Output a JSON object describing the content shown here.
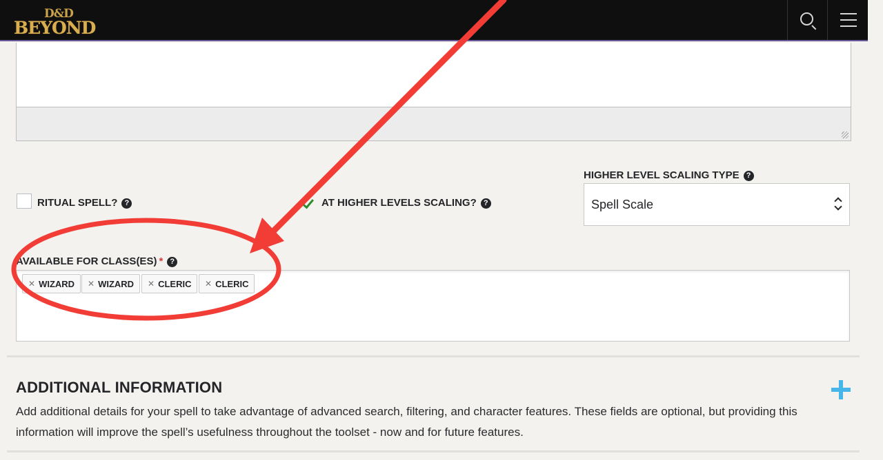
{
  "header": {
    "logo_top": "D&D",
    "logo_bottom": "BEYOND",
    "search_icon": "search-icon",
    "menu_icon": "hamburger-menu-icon",
    "bar_color": "#0f0f10"
  },
  "form": {
    "ritual_label": "RITUAL SPELL?",
    "ritual_checked": false,
    "higher_levels_label": "AT HIGHER LEVELS SCALING?",
    "higher_levels_checked": true,
    "scaling_type_label": "HIGHER LEVEL SCALING TYPE",
    "scaling_type_value": "Spell Scale",
    "classes_label": "AVAILABLE FOR CLASS(ES)",
    "required_mark": "*",
    "help_glyph": "?",
    "classes": [
      "WIZARD",
      "WIZARD",
      "CLERIC",
      "CLERIC"
    ]
  },
  "additional": {
    "title": "ADDITIONAL INFORMATION",
    "description": "Add additional details for your spell to take advantage of advanced search, filtering, and character features. These fields are optional, but providing this information will improve the spell’s usefulness throughout the toolset - now and for future features.",
    "expand_icon": "plus-icon"
  },
  "colors": {
    "accent_blue": "#46b6ea",
    "annotation_red": "#f23c36",
    "required_red": "#d63b3b",
    "check_green": "#2e8b2e"
  }
}
